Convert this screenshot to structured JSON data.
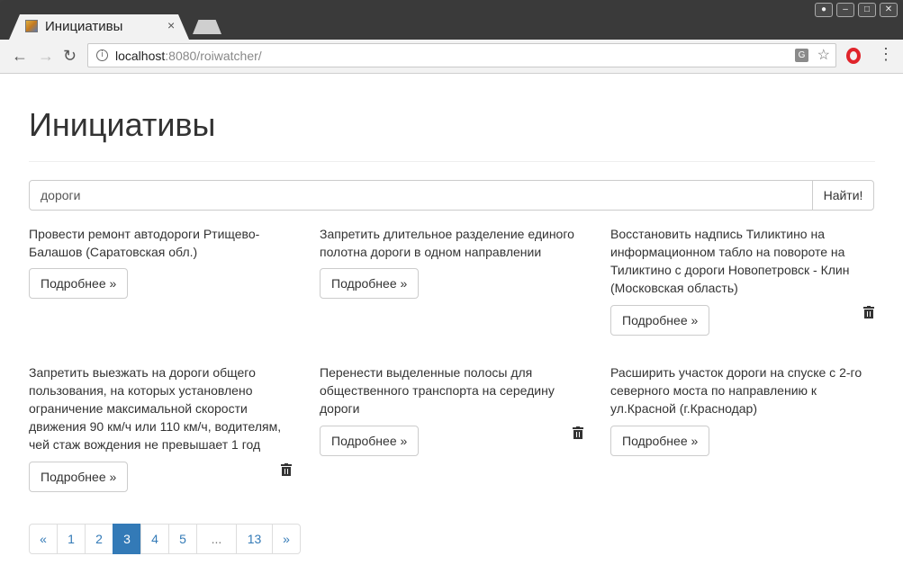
{
  "browser": {
    "tab_title": "Инициативы",
    "close_glyph": "×",
    "url_host": "localhost",
    "url_path": ":8080/roiwatcher/",
    "icons": {
      "back": "arrow-left-icon",
      "forward": "arrow-right-icon",
      "reload": "reload-icon",
      "info": "info-icon",
      "translate": "translate-icon",
      "bookmark": "star-icon",
      "opera": "opera-icon",
      "menu": "kebab-menu-icon"
    }
  },
  "page": {
    "title": "Инициативы",
    "search": {
      "value": "дороги",
      "button_label": "Найти!"
    },
    "more_label": "Подробнее »",
    "initiatives": [
      {
        "text": "Провести ремонт автодороги Ртищево-Балашов (Саратовская обл.)",
        "deletable": false
      },
      {
        "text": "Запретить длительное разделение единого полотна дороги в одном направлении",
        "deletable": false
      },
      {
        "text": "Восстановить надпись Тиликтино на информационном табло на повороте на Тиликтино с дороги Новопетровск - Клин (Московская область)",
        "deletable": true
      },
      {
        "text": "Запретить выезжать на дороги общего пользования, на которых установлено ограничение максимальной скорости движения 90 км/ч или 110 км/ч, водителям, чей стаж вождения не превышает 1 год",
        "deletable": true
      },
      {
        "text": "Перенести выделенные полосы для общественного транспорта на середину дороги",
        "deletable": true
      },
      {
        "text": "Расширить участок дороги на спуске с 2-го северного моста по направлению к ул.Красной (г.Краснодар)",
        "deletable": false
      }
    ],
    "pagination": {
      "prev": "«",
      "next": "»",
      "pages": [
        "1",
        "2",
        "3",
        "4",
        "5",
        "...",
        "13"
      ],
      "active": "3"
    }
  },
  "colors": {
    "accent": "#337ab7",
    "text": "#333333"
  }
}
